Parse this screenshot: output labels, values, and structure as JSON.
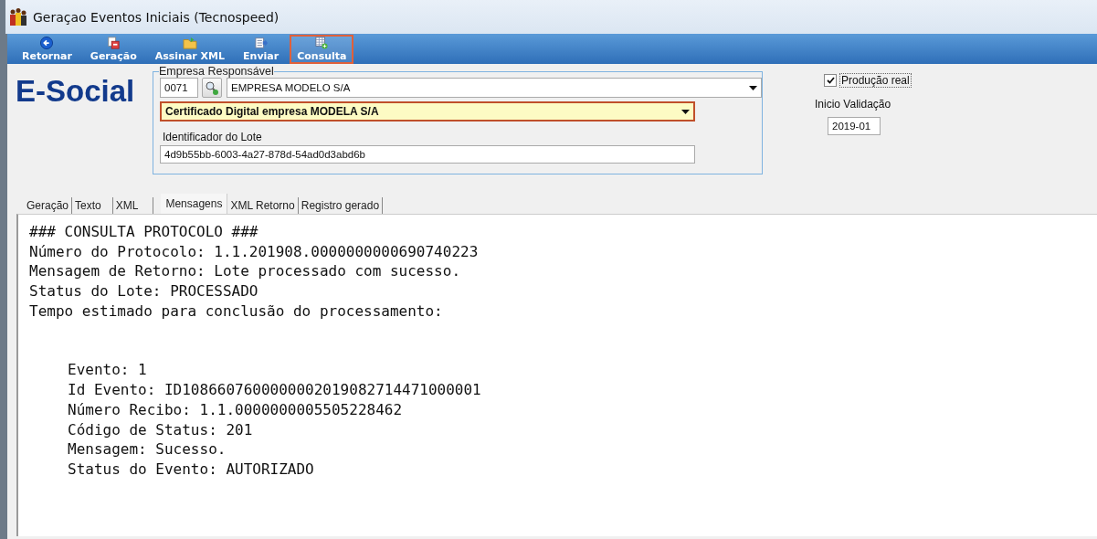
{
  "window": {
    "title": "Geraçao Eventos Iniciais (Tecnospeed)"
  },
  "toolbar": [
    {
      "label": "Retornar",
      "kind": "back",
      "selected": false
    },
    {
      "label": "Geração",
      "kind": "generate",
      "selected": false
    },
    {
      "label": "Assinar XML",
      "kind": "folder",
      "selected": false
    },
    {
      "label": "Enviar",
      "kind": "send",
      "selected": false
    },
    {
      "label": "Consulta",
      "kind": "query",
      "selected": true
    }
  ],
  "logo": "E-Social",
  "empresa": {
    "group_label": "Empresa Responsável",
    "code": "0071",
    "company": "EMPRESA MODELO S/A",
    "certificate": "Certificado Digital empresa MODELA S/A",
    "certificate_focused": true,
    "batch_label": "Identificador do Lote",
    "batch_id": "4d9b55bb-6003-4a27-878d-54ad0d3abd6b"
  },
  "producao_real": {
    "label": "Produção real",
    "checked": true
  },
  "inicio_validacao": {
    "label": "Inicio Validação",
    "value": "2019-01"
  },
  "tabs": [
    {
      "label": "Geração",
      "selected": false
    },
    {
      "label": "Texto",
      "selected": false
    },
    {
      "label": "XML",
      "selected": false
    },
    {
      "label": "Mensagens",
      "selected": true
    },
    {
      "label": "XML Retorno",
      "selected": false
    },
    {
      "label": "Registro gerado",
      "selected": false
    }
  ],
  "message": {
    "header_lines": [
      "### CONSULTA PROTOCOLO ###",
      "Número do Protocolo: 1.1.201908.0000000000690740223",
      "Mensagem de Retorno: Lote processado com sucesso.",
      "Status do Lote: PROCESSADO",
      "Tempo estimado para conclusão do processamento:"
    ],
    "event_lines": [
      "Evento: 1",
      "Id Evento: ID1086607600000002019082714471000001",
      "Número Recibo: 1.1.0000000005505228462",
      "Código de Status: 201",
      "Mensagem: Sucesso.",
      "Status do Evento: AUTORIZADO"
    ]
  }
}
